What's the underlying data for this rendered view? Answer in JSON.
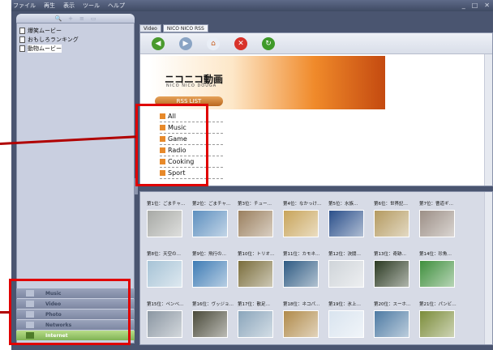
{
  "menu": [
    "ファイル",
    "再生",
    "表示",
    "ツール",
    "ヘルプ"
  ],
  "window_buttons": [
    "_",
    "□",
    "✕"
  ],
  "left_toolbar": [
    "🔍",
    "+",
    "≡",
    "▭"
  ],
  "tree": [
    {
      "label": "爆笑ムービー",
      "selected": false
    },
    {
      "label": "おもしろランキング",
      "selected": false
    },
    {
      "label": "動物ムービー",
      "selected": true
    }
  ],
  "categories": [
    {
      "label": "Music",
      "active": false
    },
    {
      "label": "Video",
      "active": false
    },
    {
      "label": "Photo",
      "active": false
    },
    {
      "label": "Networks",
      "active": false
    },
    {
      "label": "Internet",
      "active": true
    }
  ],
  "tabs": [
    "Video",
    "NICO NICO RSS"
  ],
  "browser": {
    "logo": "ニコニコ動画",
    "logo_sub": "NICO NICO DOUGA",
    "rss_heading": "RSS LIST",
    "rss_items": [
      "All",
      "Music",
      "Game",
      "Radio",
      "Cooking",
      "Sport"
    ]
  },
  "thumbnails": [
    {
      "caption": "第1位：ごまチャ…",
      "color": "#a7a9a5"
    },
    {
      "caption": "第2位：ごまチャ…",
      "color": "#5d8fbf"
    },
    {
      "caption": "第3位：チュー…",
      "color": "#9a7f5e"
    },
    {
      "caption": "第4位：なかっけ…",
      "color": "#c8a45a"
    },
    {
      "caption": "第5位：水族…",
      "color": "#2a4f8a"
    },
    {
      "caption": "第6位：世界記…",
      "color": "#b49a60"
    },
    {
      "caption": "第7位：曹道ギ…",
      "color": "#9c8f86"
    },
    {
      "caption": "第8位：天空の…",
      "color": "#a6c3d6"
    },
    {
      "caption": "第9位：飛行の…",
      "color": "#3f7cb5"
    },
    {
      "caption": "第10位：トリオ…",
      "color": "#7a6d3b"
    },
    {
      "caption": "第11位：カモネ…",
      "color": "#2f5b83"
    },
    {
      "caption": "第12位：決闘…",
      "color": "#cfd4d9"
    },
    {
      "caption": "第13位：奇跡…",
      "color": "#2b3a22"
    },
    {
      "caption": "第14位：珍魚…",
      "color": "#3f8f3d"
    },
    {
      "caption": "第15位：ペンベ…",
      "color": "#8a96a2"
    },
    {
      "caption": "第16位：ヴッジョ…",
      "color": "#4a4a3a"
    },
    {
      "caption": "第17位：散足…",
      "color": "#8aa5bb"
    },
    {
      "caption": "第18位：ネコパ…",
      "color": "#b08a4a"
    },
    {
      "caption": "第19位：氷上…",
      "color": "#d9e4ef"
    },
    {
      "caption": "第20位：スーホ…",
      "color": "#4d7aa3"
    },
    {
      "caption": "第21位：パンビ…",
      "color": "#7b8c3a"
    }
  ]
}
